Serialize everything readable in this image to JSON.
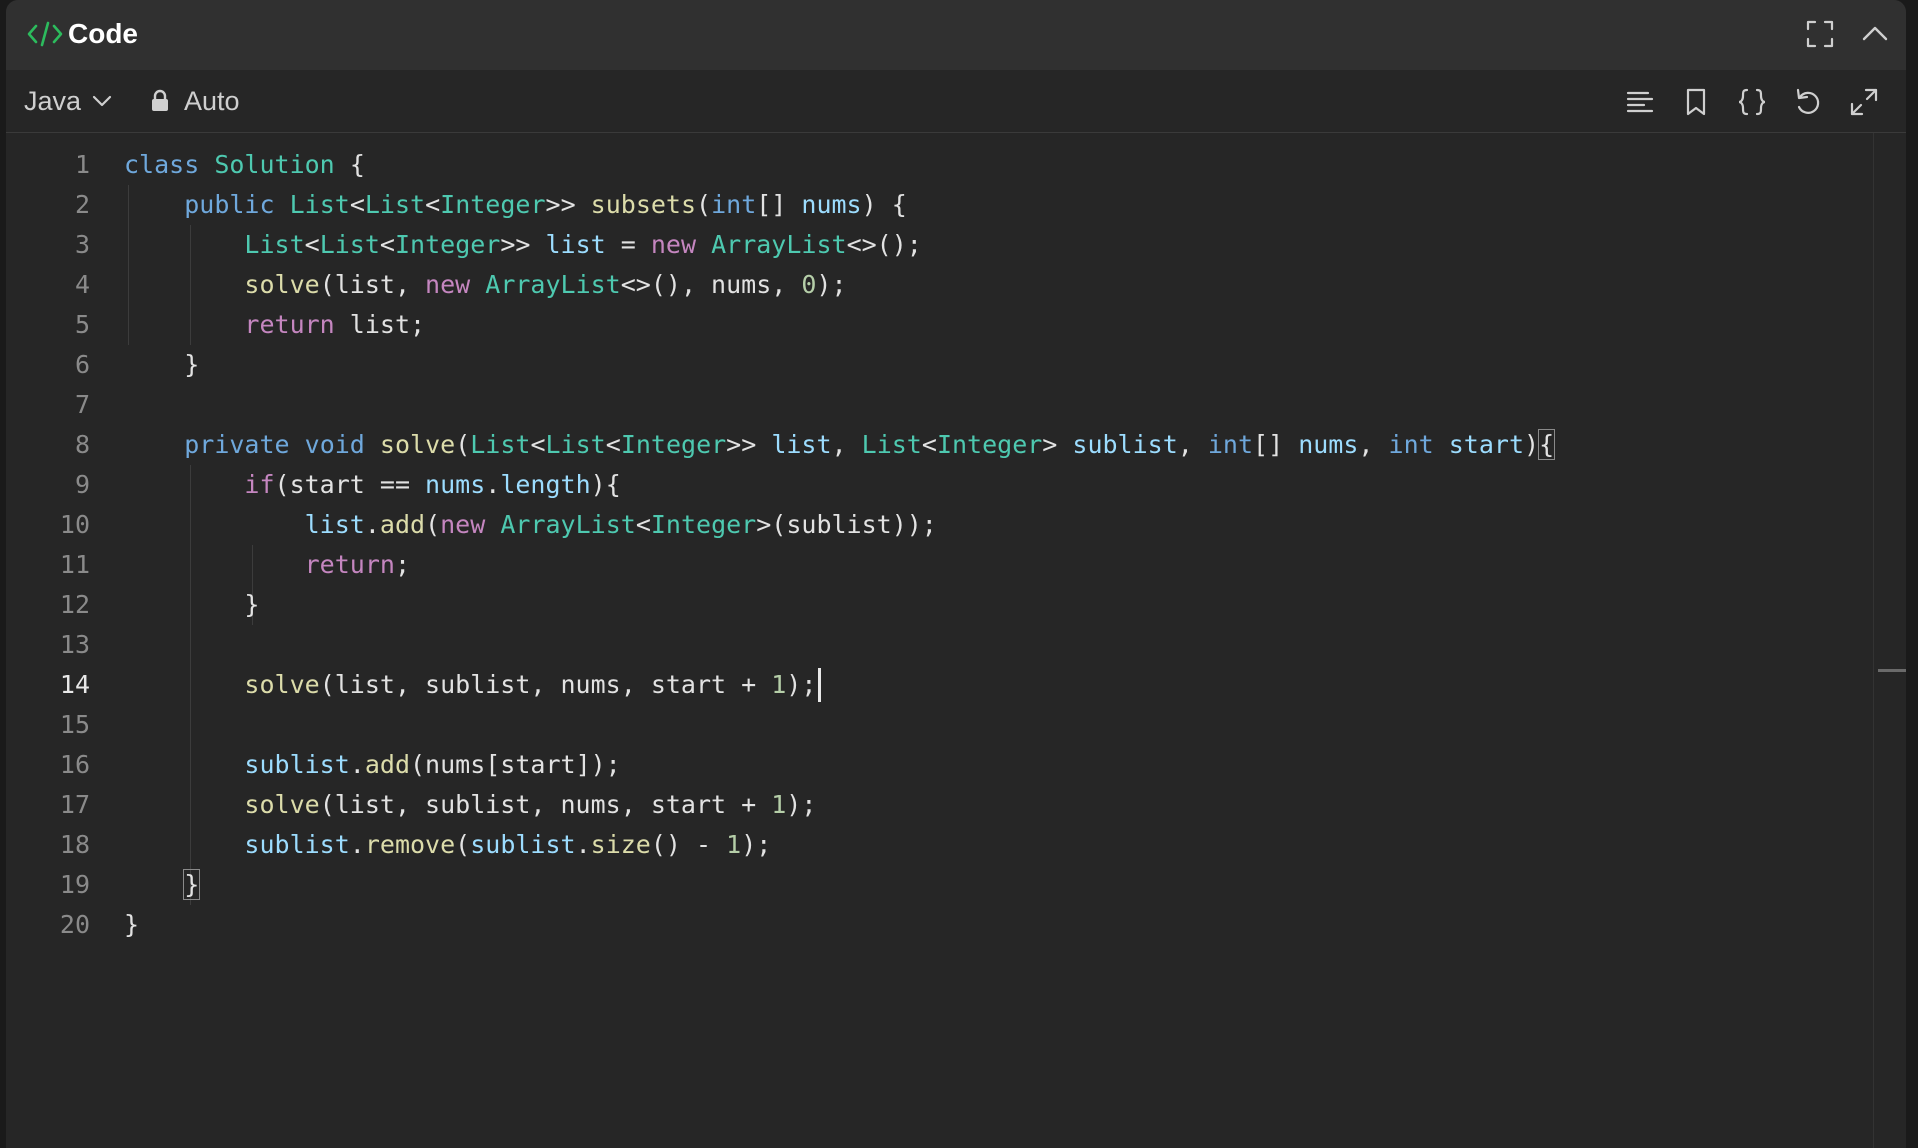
{
  "window": {
    "title": "Code"
  },
  "toolbar": {
    "language": "Java",
    "mode": "Auto"
  },
  "icons": {
    "title": "code-icon",
    "fullscreen": "fullscreen-icon",
    "collapse": "chevron-up-icon",
    "lang_dropdown": "chevron-down-icon",
    "lock": "lock-icon",
    "format": "format-icon",
    "bookmark": "bookmark-icon",
    "braces": "braces-icon",
    "reset": "undo-icon",
    "expand": "expand-icon"
  },
  "editor": {
    "active_line": 14,
    "line_numbers": [
      "1",
      "2",
      "3",
      "4",
      "5",
      "6",
      "7",
      "8",
      "9",
      "10",
      "11",
      "12",
      "13",
      "14",
      "15",
      "16",
      "17",
      "18",
      "19",
      "20"
    ]
  },
  "colors": {
    "accent_green": "#2cbb5d",
    "keyword": "#6fa8dc",
    "control": "#c586c0",
    "type": "#4ec9b0",
    "function": "#dcdcaa",
    "variable": "#9cdcfe",
    "number": "#b5cea8"
  }
}
